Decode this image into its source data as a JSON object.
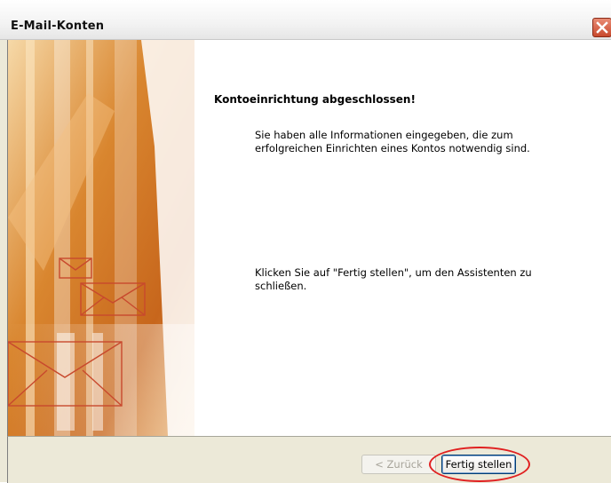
{
  "window": {
    "title": "E-Mail-Konten",
    "close_icon": "close-icon",
    "accent": "#c8492d"
  },
  "main": {
    "heading": "Kontoeinrichtung abgeschlossen!",
    "paragraph1": "Sie haben alle Informationen eingegeben, die zum erfolgreichen Einrichten eines Kontos notwendig sind.",
    "paragraph2": "Klicken Sie auf \"Fertig stellen\", um den Assistenten zu schließen."
  },
  "buttons": {
    "back_label": "< Zurück",
    "finish_label": "Fertig stellen"
  },
  "colors": {
    "highlight": "#e02020",
    "art_orange": "#d9862f"
  }
}
